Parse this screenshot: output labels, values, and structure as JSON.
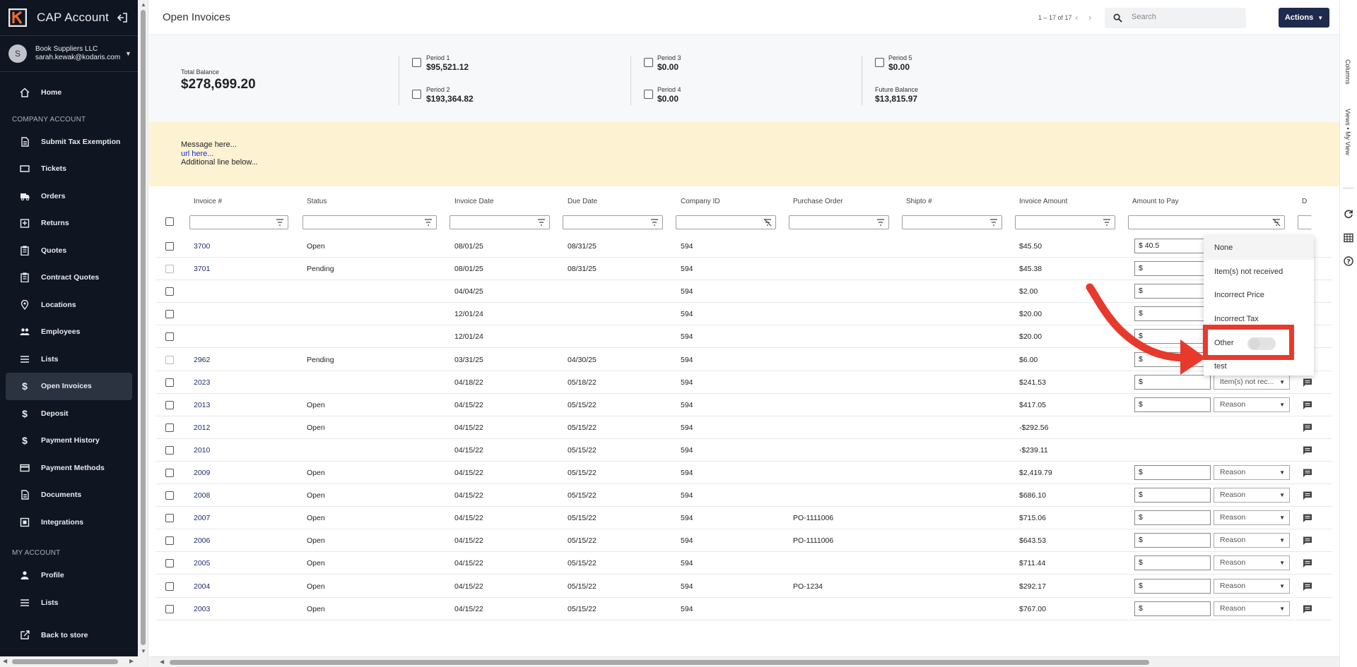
{
  "app": {
    "title": "CAP Account"
  },
  "user": {
    "initial": "S",
    "company": "Book Suppliers LLC",
    "email": "sarah.kewak@kodaris.com"
  },
  "sidebar": {
    "section_company": "COMPANY ACCOUNT",
    "section_my": "MY ACCOUNT",
    "home": {
      "label": "Home",
      "icon": "home-icon"
    },
    "company_items": [
      {
        "label": "Submit Tax Exemption",
        "icon": "document-icon"
      },
      {
        "label": "Tickets",
        "icon": "ticket-icon"
      },
      {
        "label": "Orders",
        "icon": "truck-icon"
      },
      {
        "label": "Returns",
        "icon": "returns-icon"
      },
      {
        "label": "Quotes",
        "icon": "clipboard-icon"
      },
      {
        "label": "Contract Quotes",
        "icon": "clipboard-icon"
      },
      {
        "label": "Locations",
        "icon": "location-pin-icon"
      },
      {
        "label": "Employees",
        "icon": "people-icon"
      },
      {
        "label": "Lists",
        "icon": "list-icon"
      },
      {
        "label": "Open Invoices",
        "icon": "dollar-icon"
      },
      {
        "label": "Deposit",
        "icon": "dollar-icon"
      },
      {
        "label": "Payment History",
        "icon": "dollar-icon"
      },
      {
        "label": "Payment Methods",
        "icon": "credit-card-icon"
      },
      {
        "label": "Documents",
        "icon": "document-icon"
      },
      {
        "label": "Integrations",
        "icon": "integration-icon"
      }
    ],
    "my_items": [
      {
        "label": "Profile",
        "icon": "person-icon"
      },
      {
        "label": "Lists",
        "icon": "list-icon"
      }
    ],
    "back": {
      "label": "Back to store",
      "icon": "external-link-icon"
    },
    "active": "Open Invoices"
  },
  "header": {
    "title": "Open Invoices",
    "pager": "1 – 17 of 17",
    "search_placeholder": "Search",
    "actions_label": "Actions"
  },
  "rail": {
    "columns": "Columns",
    "views": "Views • My View"
  },
  "summary": {
    "total_label": "Total Balance",
    "total_value": "$278,699.20",
    "p1_label": "Period 1",
    "p1_value": "$95,521.12",
    "p2_label": "Period 2",
    "p2_value": "$193,364.82",
    "p3_label": "Period 3",
    "p3_value": "$0.00",
    "p4_label": "Period 4",
    "p4_value": "$0.00",
    "p5_label": "Period 5",
    "p5_value": "$0.00",
    "future_label": "Future Balance",
    "future_value": "$13,815.97"
  },
  "message": {
    "line1": "Message here...",
    "link": "url here...",
    "line3": "Additional line below..."
  },
  "table": {
    "columns": [
      "Invoice #",
      "Status",
      "Invoice Date",
      "Due Date",
      "Company ID",
      "Purchase Order",
      "Shipto #",
      "Invoice Amount",
      "Amount to Pay",
      "D"
    ],
    "rows": [
      {
        "invoice": "3700",
        "status": "Open",
        "inv_date": "08/01/25",
        "due": "08/31/25",
        "company": "594",
        "po": "",
        "amount": "$45.50",
        "pay": "$ 40.5",
        "reason": "",
        "cb_dim": false
      },
      {
        "invoice": "3701",
        "status": "Pending",
        "inv_date": "08/01/25",
        "due": "08/31/25",
        "company": "594",
        "po": "",
        "amount": "$45.38",
        "pay": "$",
        "reason": "",
        "cb_dim": true
      },
      {
        "invoice": "",
        "status": "",
        "inv_date": "04/04/25",
        "due": "",
        "company": "594",
        "po": "",
        "amount": "$2.00",
        "pay": "$",
        "reason": "",
        "cb_dim": false
      },
      {
        "invoice": "",
        "status": "",
        "inv_date": "12/01/24",
        "due": "",
        "company": "594",
        "po": "",
        "amount": "$20.00",
        "pay": "$",
        "reason": "",
        "cb_dim": false
      },
      {
        "invoice": "",
        "status": "",
        "inv_date": "12/01/24",
        "due": "",
        "company": "594",
        "po": "",
        "amount": "$20.00",
        "pay": "$",
        "reason": "",
        "cb_dim": false
      },
      {
        "invoice": "2962",
        "status": "Pending",
        "inv_date": "03/31/25",
        "due": "04/30/25",
        "company": "594",
        "po": "",
        "amount": "$6.00",
        "pay": "$",
        "reason": "",
        "cb_dim": true
      },
      {
        "invoice": "2023",
        "status": "",
        "inv_date": "04/18/22",
        "due": "05/18/22",
        "company": "594",
        "po": "",
        "amount": "$241.53",
        "pay": "$",
        "reason": "Item(s) not rec...",
        "cb_dim": false
      },
      {
        "invoice": "2013",
        "status": "Open",
        "inv_date": "04/15/22",
        "due": "05/15/22",
        "company": "594",
        "po": "",
        "amount": "$417.05",
        "pay": "$",
        "reason": "Reason",
        "cb_dim": false
      },
      {
        "invoice": "2012",
        "status": "Open",
        "inv_date": "04/15/22",
        "due": "05/15/22",
        "company": "594",
        "po": "",
        "amount": "-$292.56",
        "pay": null,
        "reason": null,
        "cb_dim": false
      },
      {
        "invoice": "2010",
        "status": "",
        "inv_date": "04/15/22",
        "due": "05/15/22",
        "company": "594",
        "po": "",
        "amount": "-$239.11",
        "pay": null,
        "reason": null,
        "cb_dim": false
      },
      {
        "invoice": "2009",
        "status": "Open",
        "inv_date": "04/15/22",
        "due": "05/15/22",
        "company": "594",
        "po": "",
        "amount": "$2,419.79",
        "pay": "$",
        "reason": "Reason",
        "cb_dim": false
      },
      {
        "invoice": "2008",
        "status": "Open",
        "inv_date": "04/15/22",
        "due": "05/15/22",
        "company": "594",
        "po": "",
        "amount": "$686.10",
        "pay": "$",
        "reason": "Reason",
        "cb_dim": false
      },
      {
        "invoice": "2007",
        "status": "Open",
        "inv_date": "04/15/22",
        "due": "05/15/22",
        "company": "594",
        "po": "PO-1111006",
        "amount": "$715.06",
        "pay": "$",
        "reason": "Reason",
        "cb_dim": false
      },
      {
        "invoice": "2006",
        "status": "Open",
        "inv_date": "04/15/22",
        "due": "05/15/22",
        "company": "594",
        "po": "PO-1111006",
        "amount": "$643.53",
        "pay": "$",
        "reason": "Reason",
        "cb_dim": false
      },
      {
        "invoice": "2005",
        "status": "Open",
        "inv_date": "04/15/22",
        "due": "05/15/22",
        "company": "594",
        "po": "",
        "amount": "$711.44",
        "pay": "$",
        "reason": "Reason",
        "cb_dim": false
      },
      {
        "invoice": "2004",
        "status": "Open",
        "inv_date": "04/15/22",
        "due": "05/15/22",
        "company": "594",
        "po": "PO-1234",
        "amount": "$292.17",
        "pay": "$",
        "reason": "Reason",
        "cb_dim": false
      },
      {
        "invoice": "2003",
        "status": "Open",
        "inv_date": "04/15/22",
        "due": "05/15/22",
        "company": "594",
        "po": "",
        "amount": "$767.00",
        "pay": "$",
        "reason": "Reason",
        "cb_dim": false
      }
    ]
  },
  "dropdown": {
    "options": [
      "None",
      "Item(s) not received",
      "Incorrect Price",
      "Incorrect Tax",
      "Other",
      "test"
    ],
    "highlighted": "Other"
  },
  "colors": {
    "sidebar_bg": "#0f1521",
    "accent": "#1f2b4d",
    "message_bg": "#fdf3d3",
    "annotation": "#e8392d",
    "link": "#1a2dd6"
  }
}
